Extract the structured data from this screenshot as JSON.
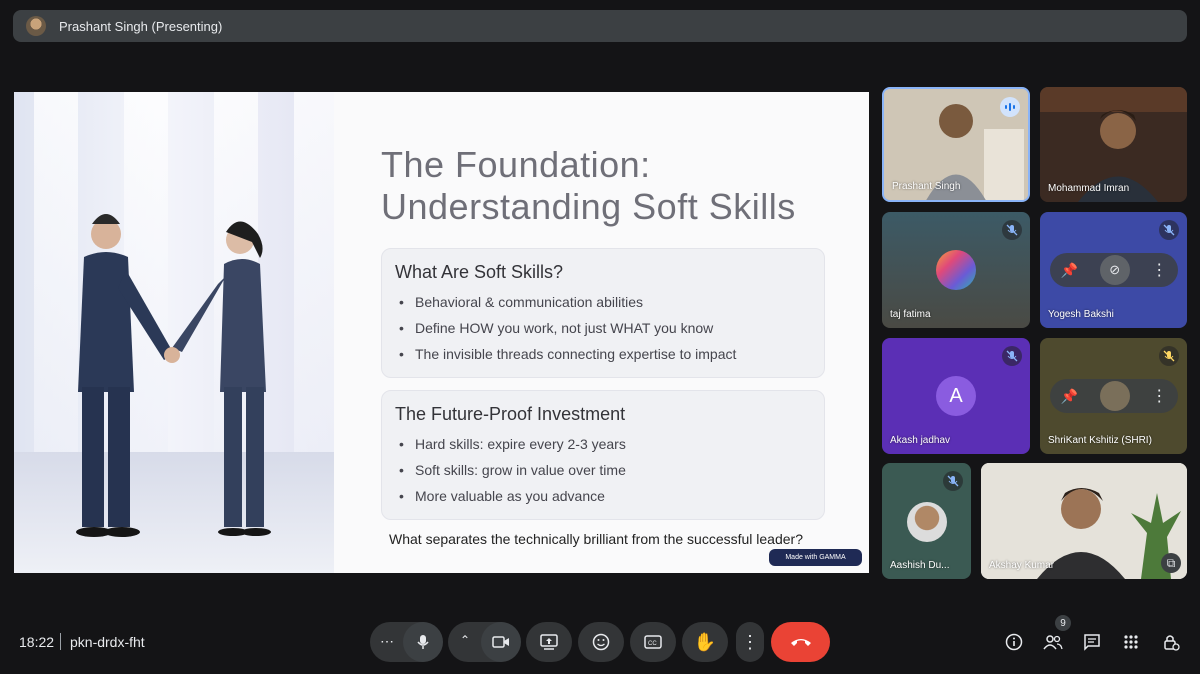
{
  "presenting_bar": {
    "presenter_label": "Prashant Singh (Presenting)"
  },
  "slide": {
    "title_line1": "The Foundation:",
    "title_line2": "Understanding Soft Skills",
    "cards": [
      {
        "heading": "What Are Soft Skills?",
        "bullets": [
          "Behavioral & communication abilities",
          "Define HOW you work, not just WHAT you know",
          "The invisible threads connecting expertise to impact"
        ]
      },
      {
        "heading": "The Future-Proof Investment",
        "bullets": [
          "Hard skills: expire every 2-3 years",
          "Soft skills: grow in value over time",
          "More valuable as you advance"
        ]
      }
    ],
    "question": "What separates the technically brilliant from the successful leader?",
    "badge": "Made with GAMMA"
  },
  "participants": [
    {
      "name": "Prashant Singh",
      "state": "speaking"
    },
    {
      "name": "Mohammad Imran",
      "state": "video"
    },
    {
      "name": "taj fatima",
      "state": "muted"
    },
    {
      "name": "Yogesh Bakshi",
      "state": "muted"
    },
    {
      "name": "Akash jadhav",
      "state": "muted",
      "initial": "A"
    },
    {
      "name": "ShriKant Kshitiz (SHRI)",
      "state": "muted"
    },
    {
      "name": "Aashish Du...",
      "state": "muted"
    },
    {
      "name": "Akshay Kumar",
      "state": "video"
    }
  ],
  "meeting": {
    "time": "18:22",
    "code": "pkn-drdx-fht",
    "participant_count": "9"
  },
  "colors": {
    "leave_button": "#ea4335",
    "speaking_blue": "#8ab4f8",
    "slide_badge": "#1f2a55"
  }
}
